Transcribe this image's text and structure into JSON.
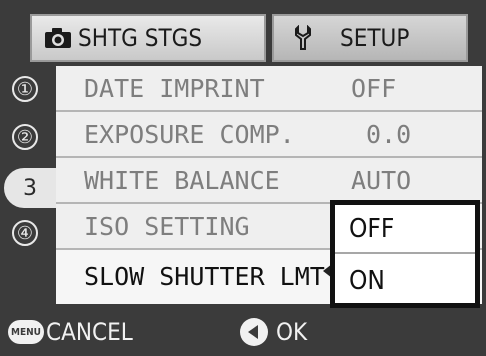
{
  "tabs": {
    "shooting_label": "SHTG STGS",
    "shooting_icon": "camera-icon",
    "setup_label": "SETUP",
    "setup_icon": "wrench-icon"
  },
  "pages": [
    "①",
    "②",
    "3",
    "④"
  ],
  "menu": {
    "items": [
      {
        "label": "DATE IMPRINT",
        "value": "OFF"
      },
      {
        "label": "EXPOSURE COMP.",
        "value": "0.0"
      },
      {
        "label": "WHITE BALANCE",
        "value": "AUTO"
      },
      {
        "label": "ISO SETTING",
        "value": ""
      },
      {
        "label": "SLOW SHUTTER LMT",
        "value": ""
      }
    ]
  },
  "dropdown": {
    "options": [
      "OFF",
      "ON"
    ]
  },
  "footer": {
    "menu_badge": "MENU",
    "cancel_label": "CANCEL",
    "ok_label": "OK"
  }
}
